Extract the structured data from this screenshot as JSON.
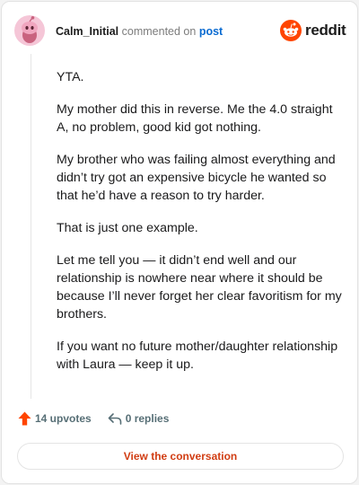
{
  "header": {
    "username": "Calm_Initial",
    "commented_text": "commented on",
    "post_link": "post",
    "avatar_icon": "snoo-avatar-icon",
    "avatar_bg": "#f5c6d7"
  },
  "logo": {
    "icon": "reddit-snoo-icon",
    "text": "reddit",
    "color": "#ff4500"
  },
  "comment": {
    "paragraphs": [
      "YTA.",
      "My mother did this in reverse. Me the 4.0 straight A, no problem, good kid got nothing.",
      "My brother who was failing almost everything and didn’t try got an expensive bicycle he wanted so that he’d have a reason to try harder.",
      "That is just one example.",
      "Let me tell you — it didn’t end well and our relationship is nowhere near where it should be because I’ll never forget her clear favoritism for my brothers.",
      "If you want no future mother/daughter relationship with Laura — keep it up."
    ]
  },
  "footer": {
    "upvotes_icon": "upvote-arrow-icon",
    "upvotes_label": "14 upvotes",
    "replies_icon": "reply-arrow-icon",
    "replies_label": "0 replies",
    "accent_color": "#ff4500"
  },
  "cta": {
    "label": "View the conversation",
    "color": "#d13d13"
  }
}
